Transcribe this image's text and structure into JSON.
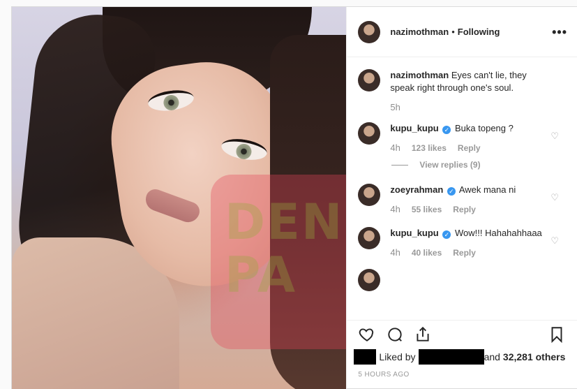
{
  "post": {
    "author": "nazimothman",
    "follow_status": "Following",
    "separator": "•",
    "more_label": "•••",
    "caption": "Eyes can't lie, they speak right through one's soul.",
    "caption_time": "5h"
  },
  "watermark": {
    "line1": "DEN",
    "line2": "PA"
  },
  "comments": [
    {
      "user": "kupu_kupu",
      "verified": true,
      "text": "Buka topeng ?",
      "time": "4h",
      "likes": "123 likes",
      "reply": "Reply",
      "view_replies": "View replies (9)"
    },
    {
      "user": "zoeyrahman",
      "verified": true,
      "text": "Awek mana ni",
      "time": "4h",
      "likes": "55 likes",
      "reply": "Reply"
    },
    {
      "user": "kupu_kupu",
      "verified": true,
      "text": "Wow!!! Hahahahhaaa",
      "time": "4h",
      "likes": "40 likes",
      "reply": "Reply"
    }
  ],
  "likes": {
    "prefix": "Liked by",
    "suffix_and": "and",
    "others": "32,281 others"
  },
  "timestamp": "5 HOURS AGO",
  "icons": {
    "more": "more-options-icon",
    "heart": "heart-icon",
    "comment": "comment-icon",
    "share": "share-icon",
    "bookmark": "bookmark-icon",
    "verified": "verified-badge-icon"
  },
  "colors": {
    "verified": "#3897f0",
    "muted": "#999999",
    "text": "#262626"
  }
}
